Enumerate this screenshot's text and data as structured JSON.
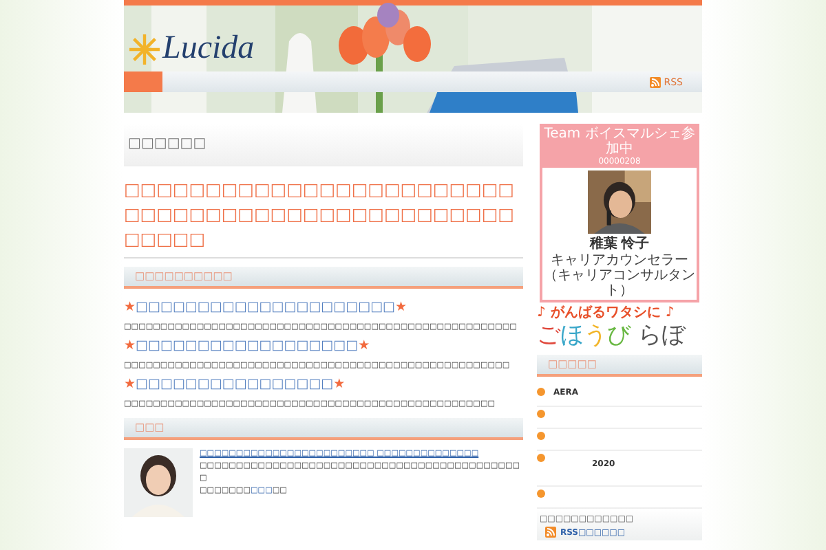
{
  "header": {
    "logo": "Lucida",
    "rss": "RSS"
  },
  "main": {
    "page_title": "□□□□□□",
    "headline": "□□□□□□□□□□□□□□□□□□□□□□□□□□□□□□□□□□□□□□□□□□□□□□□□□□□□□",
    "section_title": "□□□□□□□□□□",
    "entries": [
      {
        "heading": "★□□□□□□□□□□□□□□□□□□□□□★",
        "body": "□□□□□□□□□□□□□□□□□□□□□□□□□□□□□□□□□□□□□□□□□□□□□□□□□□□□□□"
      },
      {
        "heading": "★□□□□□□□□□□□□□□□□□□★",
        "body": "□□□□□□□□□□□□□□□□□□□□□□□□□□□□□□□□□□□□□□□□□□□□□□□□□□□□□"
      },
      {
        "heading": "★□□□□□□□□□□□□□□□□★",
        "body": "□□□□□□□□□□□□□□□□□□□□□□□□□□□□□□□□□□□□□□□□□□□□□□□□□□□"
      }
    ],
    "profile_title": "□□□",
    "profile": {
      "link": "□□□□□□□□□□□□□□□□□□□□□□□□ □□□□□□□□□□□□□□",
      "text": "□□□□□□□□□□□□□□□□□□□□□□□□□□□□□□□□□□□□□□□□□□□□□",
      "more_before": "□□□□□□□",
      "more_link": "□□□",
      "more_after": "□□"
    }
  },
  "sidebar": {
    "badge": {
      "title": "Team ボイスマルシェ参加中",
      "number": "00000208",
      "name": "稚葉 怜子",
      "role": "キャリアカウンセラー（キャリアコンサルタント）"
    },
    "banner": {
      "tagline": "♪ がんばるワタシに ♪",
      "letters": [
        {
          "text": "ご",
          "color": "#e0483c"
        },
        {
          "text": "ほ",
          "color": "#3aa7c9"
        },
        {
          "text": "う",
          "color": "#f2b52a"
        },
        {
          "text": "び",
          "color": "#69b843"
        },
        {
          "text": " らぼ",
          "color": "#555555"
        }
      ]
    },
    "list_title": "□□□□□",
    "list": [
      {
        "kind": "text",
        "text": "AERA"
      },
      {
        "kind": "empty"
      },
      {
        "kind": "empty"
      },
      {
        "kind": "year",
        "text": "2020"
      },
      {
        "kind": "empty"
      }
    ],
    "footer_text": "□□□□□□□□□□□□",
    "rss_label": "RSS",
    "rss_link": "□□□□□□"
  }
}
